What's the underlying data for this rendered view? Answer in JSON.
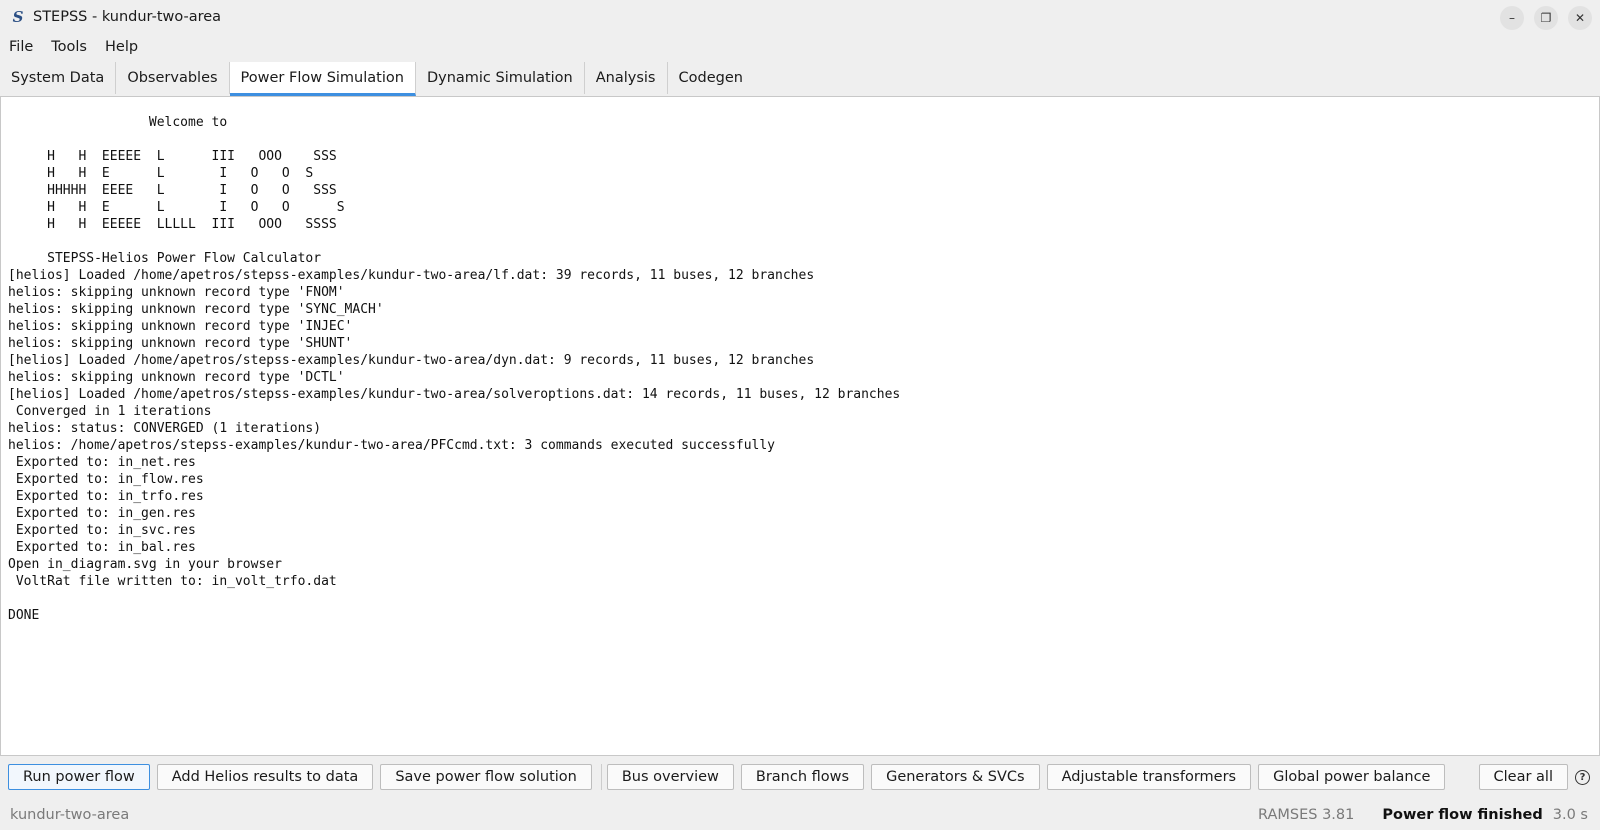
{
  "window": {
    "title": "STEPSS - kundur-two-area",
    "app_icon": "stepss-logo-icon",
    "controls": [
      "minimize",
      "restore",
      "close"
    ]
  },
  "menu": {
    "items": [
      "File",
      "Tools",
      "Help"
    ]
  },
  "tabs": {
    "items": [
      "System Data",
      "Observables",
      "Power Flow Simulation",
      "Dynamic Simulation",
      "Analysis",
      "Codegen"
    ],
    "active": "Power Flow Simulation",
    "accent_color": "#3d8fe0"
  },
  "console": {
    "text": "                  Welcome to\n\n     H   H  EEEEE  L      III   OOO    SSS\n     H   H  E      L       I   O   O  S\n     HHHHH  EEEE   L       I   O   O   SSS\n     H   H  E      L       I   O   O      S\n     H   H  EEEEE  LLLLL  III   OOO   SSSS\n\n     STEPSS-Helios Power Flow Calculator\n[helios] Loaded /home/apetros/stepss-examples/kundur-two-area/lf.dat: 39 records, 11 buses, 12 branches\nhelios: skipping unknown record type 'FNOM'\nhelios: skipping unknown record type 'SYNC_MACH'\nhelios: skipping unknown record type 'INJEC'\nhelios: skipping unknown record type 'SHUNT'\n[helios] Loaded /home/apetros/stepss-examples/kundur-two-area/dyn.dat: 9 records, 11 buses, 12 branches\nhelios: skipping unknown record type 'DCTL'\n[helios] Loaded /home/apetros/stepss-examples/kundur-two-area/solveroptions.dat: 14 records, 11 buses, 12 branches\n Converged in 1 iterations\nhelios: status: CONVERGED (1 iterations)\nhelios: /home/apetros/stepss-examples/kundur-two-area/PFCcmd.txt: 3 commands executed successfully\n Exported to: in_net.res\n Exported to: in_flow.res\n Exported to: in_trfo.res\n Exported to: in_gen.res\n Exported to: in_svc.res\n Exported to: in_bal.res\nOpen in_diagram.svg in your browser\n VoltRat file written to: in_volt_trfo.dat\n\nDONE"
  },
  "toolbar": {
    "run_power_flow": "Run power flow",
    "add_helios_results": "Add Helios results to data",
    "save_solution": "Save power flow solution",
    "bus_overview": "Bus overview",
    "branch_flows": "Branch flows",
    "generators_svcs": "Generators & SVCs",
    "adjustable_transformers": "Adjustable transformers",
    "global_power_balance": "Global power balance",
    "clear_all": "Clear all",
    "help_icon": "help-circle-icon"
  },
  "status": {
    "project": "kundur-two-area",
    "version": "RAMSES 3.81",
    "message": "Power flow finished",
    "elapsed": "3.0 s"
  }
}
